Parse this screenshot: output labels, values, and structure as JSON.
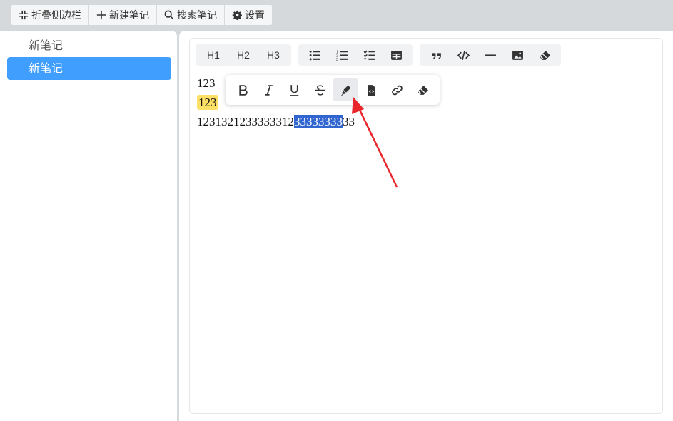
{
  "topbar": {
    "collapse_sidebar": "折叠侧边栏",
    "new_note": "新建笔记",
    "search_notes": "搜索笔记",
    "settings": "设置"
  },
  "sidebar": {
    "items": [
      {
        "label": "新笔记",
        "active": false
      },
      {
        "label": "新笔记",
        "active": true
      }
    ]
  },
  "toolbar": {
    "headings": [
      "H1",
      "H2",
      "H3"
    ]
  },
  "content": {
    "line1": "123",
    "line2_highlight": "123",
    "line3_before": "1231321233333312",
    "line3_selected": "33333333",
    "line3_after": "33"
  },
  "colors": {
    "accent": "#409eff",
    "highlight": "#ffe066",
    "selection": "#3166d0",
    "annotation_arrow": "#e8262c"
  }
}
